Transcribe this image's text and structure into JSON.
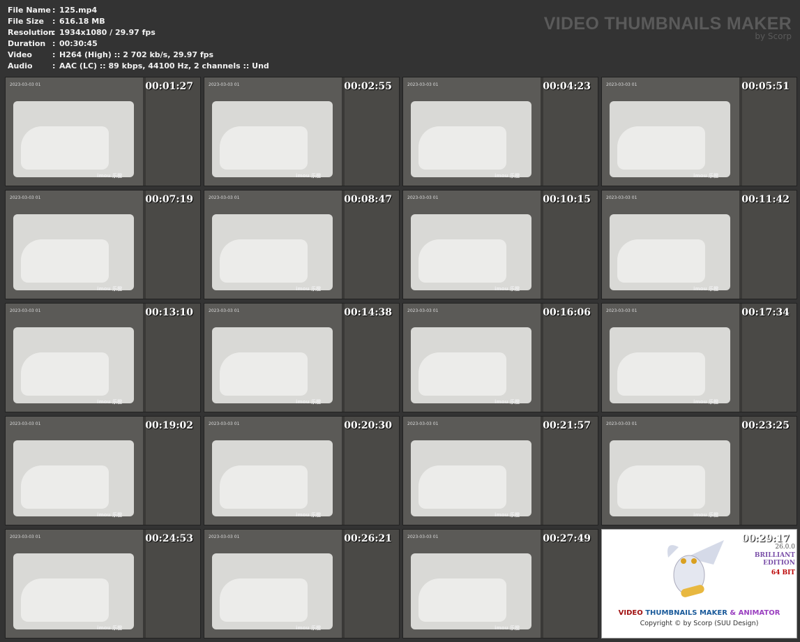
{
  "info": [
    {
      "key": "File Name",
      "value": "125.mp4"
    },
    {
      "key": "File Size",
      "value": "616.18 MB"
    },
    {
      "key": "Resolution",
      "value": "1934x1080 / 29.97 fps"
    },
    {
      "key": "Duration",
      "value": "00:30:45"
    },
    {
      "key": "Video",
      "value": "H264 (High) :: 2 702 kb/s, 29.97 fps"
    },
    {
      "key": "Audio",
      "value": "AAC (LC) :: 89 kbps, 44100 Hz, 2 channels :: Und"
    }
  ],
  "separator": ":",
  "brand": {
    "title": "VIDEO THUMBNAILS MAKER",
    "by": "by Scorp"
  },
  "frame_date": "2023-03-03 01",
  "watermark": "imou 乐橙",
  "timestamps": [
    "00:01:27",
    "00:02:55",
    "00:04:23",
    "00:05:51",
    "00:07:19",
    "00:08:47",
    "00:10:15",
    "00:11:42",
    "00:13:10",
    "00:14:38",
    "00:16:06",
    "00:17:34",
    "00:19:02",
    "00:20:30",
    "00:21:57",
    "00:23:25",
    "00:24:53",
    "00:26:21",
    "00:27:49"
  ],
  "last_tile": {
    "timestamp": "00:29:17",
    "version": "26.0.0",
    "edition1": "BRILLIANT",
    "edition2": "EDITION",
    "bits": "64 BIT",
    "logo_video": "VIDEO",
    "logo_thumb": "THUMBNAILS MAKER",
    "logo_anim": "& ANIMATOR",
    "copyright": "Copyright © by Scorp (SUU Design)"
  }
}
